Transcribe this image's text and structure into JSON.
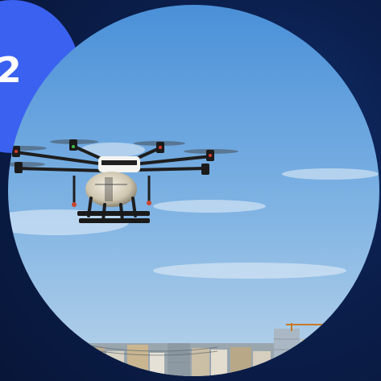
{
  "step": {
    "number": "2"
  },
  "photo": {
    "subject": "agricultural-spray-drone",
    "sky_top_color": "#4a90d8",
    "sky_bottom_color": "#b9d4ea",
    "background_color": "#0b1f4d",
    "badge_color": "#3b61f0"
  }
}
